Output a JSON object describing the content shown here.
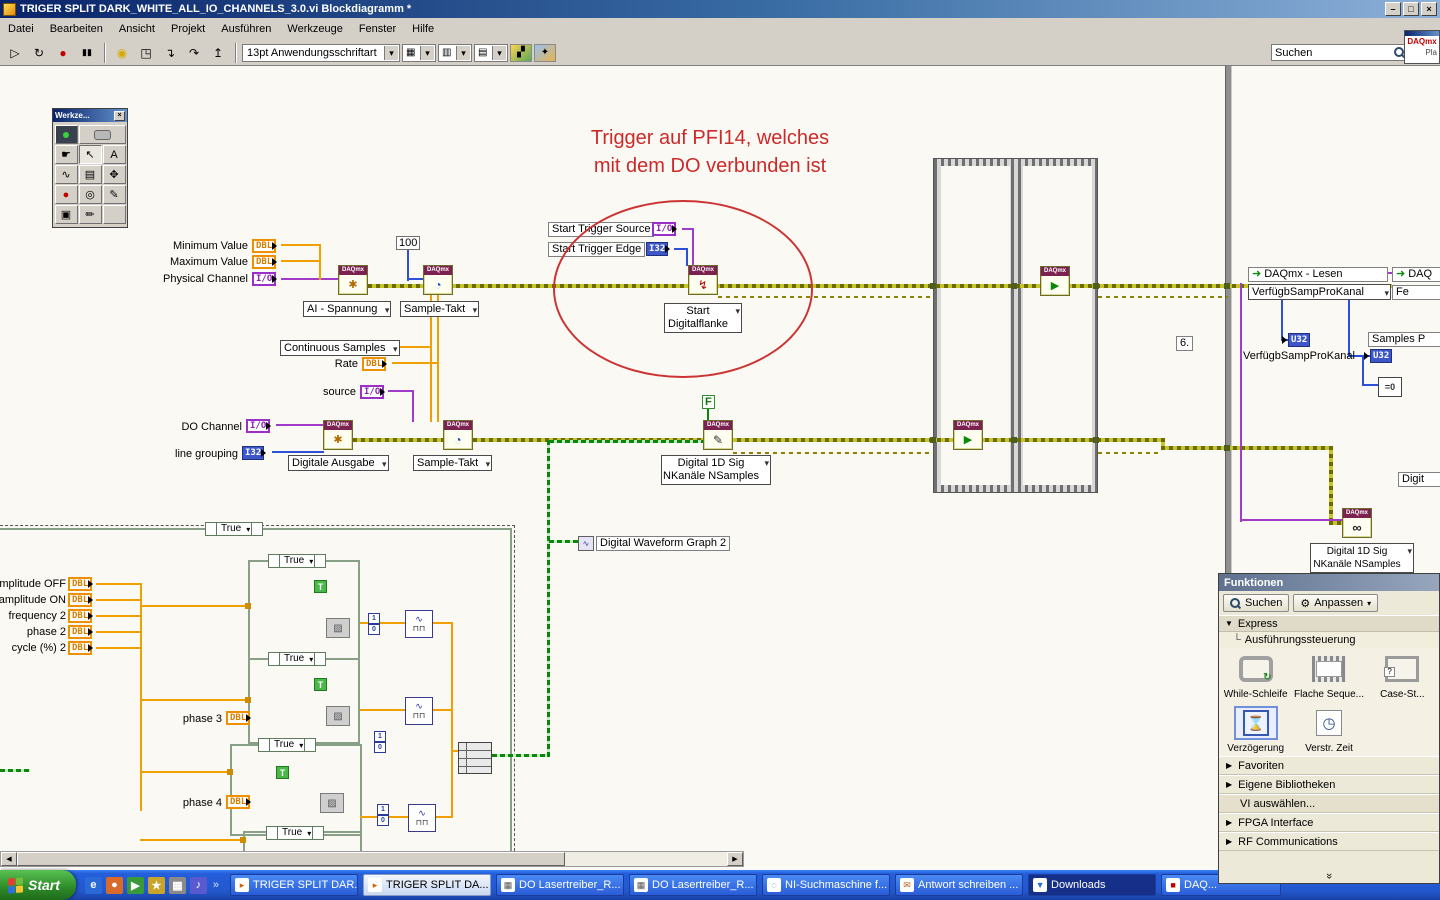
{
  "window": {
    "title": "TRIGER SPLIT DARK_WHITE_ALL_IO_CHANNELS_3.0.vi Blockdiagramm *"
  },
  "menubar": {
    "items": [
      "Datei",
      "Bearbeiten",
      "Ansicht",
      "Projekt",
      "Ausführen",
      "Werkzeuge",
      "Fenster",
      "Hilfe"
    ]
  },
  "toolbar": {
    "font": "13pt Anwendungsschriftart",
    "search": "Suchen",
    "help": "?"
  },
  "mini": {
    "brand": "DAQmx",
    "sub": "Pla"
  },
  "tools": {
    "title": "Werkze..."
  },
  "note": {
    "line1": "Trigger auf PFI14, welches",
    "line2": "mit dem DO verbunden ist"
  },
  "d": {
    "daqmx": "DAQmx",
    "dbl": "DBL",
    "io": "I/O",
    "i32": "I32",
    "u32": "U32",
    "min_value": "Minimum Value",
    "max_value": "Maximum Value",
    "phys_channel": "Physical Channel",
    "c100": "100",
    "ai_spannung": "AI - Spannung",
    "sample_takt": "Sample-Takt",
    "cont_samples": "Continuous Samples",
    "rate": "Rate",
    "source": "source",
    "trig_source": "Start Trigger Source",
    "trig_edge": "Start Trigger Edge",
    "start1": "Start",
    "start2": "Digitalflanke",
    "do_channel": "DO Channel",
    "line_grouping": "line grouping",
    "dig_ausgabe": "Digitale Ausgabe",
    "f": "F",
    "dsig1": "Digital 1D Sig",
    "dsig2": "NKanäle NSamples",
    "lesen": "DAQmx - Lesen",
    "verfuegb": "VerfügbSampProKanal",
    "samples_p": "Samples P",
    "eq0": "=0",
    "six": "6.",
    "graph": "Digital Waveform Graph 2",
    "true": "True",
    "t": "T",
    "amp_off": "amplitude OFF",
    "amp_on": "amplitude ON",
    "freq2": "frequency 2",
    "phase2": "phase 2",
    "cycle2": "cycle (%) 2",
    "phase3": "phase 3",
    "phase4": "phase 4",
    "daq_cut": "DAQ",
    "fe_cut": "Fe",
    "digit_cut": "Digit",
    "one": "1",
    "zero": "0"
  },
  "fx": {
    "title": "Funktionen",
    "search": "Suchen",
    "customize": "Anpassen",
    "express": "Express",
    "sub": "Ausführungssteuerung",
    "while_loop": "While-Schleife",
    "flat_seq": "Flache Seque...",
    "case_struct": "Case-St...",
    "delay": "Verzögerung",
    "elapsed": "Verstr. Zeit",
    "cats": [
      "Favoriten",
      "Eigene Bibliotheken",
      "VI auswählen...",
      "FPGA Interface",
      "RF Communications"
    ]
  },
  "taskbar": {
    "start": "Start",
    "tasks": [
      "TRIGER SPLIT DAR...",
      "TRIGER SPLIT DA...",
      "DO Lasertreiber_R...",
      "DO Lasertreiber_R...",
      "NI-Suchmaschine f...",
      "Antwort schreiben ...",
      "Downloads",
      "DAQ..."
    ]
  }
}
